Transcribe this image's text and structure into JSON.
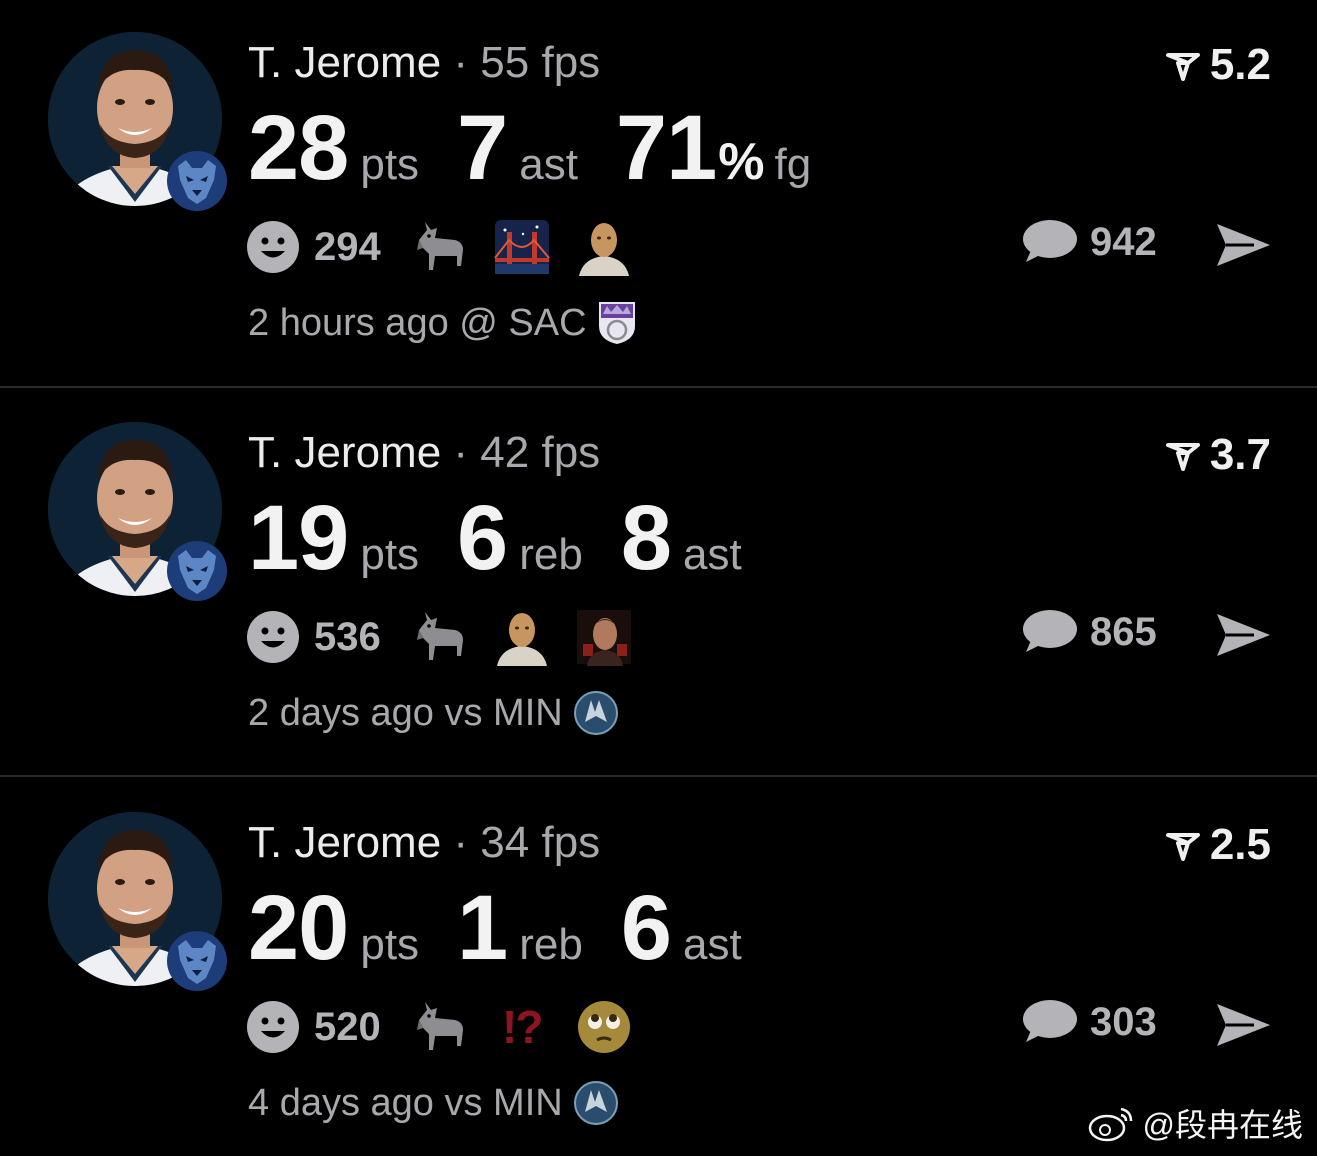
{
  "colors": {
    "background": "#000000",
    "divider": "#2a2a2c",
    "primary_text": "#f2f2f2",
    "secondary_text": "#a9a9ad",
    "icon_gray": "#b4b4b8",
    "interrobang_red": "#8d1520"
  },
  "posts": [
    {
      "player": "T. Jerome",
      "sep": "·",
      "fps": "55 fps",
      "rating": "5.2",
      "stats": [
        {
          "num": "28",
          "pct": "",
          "unit": "pts"
        },
        {
          "num": "7",
          "pct": "",
          "unit": "ast"
        },
        {
          "num": "71",
          "pct": "%",
          "unit": "fg"
        }
      ],
      "reactions_count": "294",
      "reaction_icons": [
        "goat-emoji",
        "bridge-at-night-emoji",
        "masked-person-emoji"
      ],
      "comments_count": "942",
      "time": "2 hours ago",
      "venue": "@ SAC",
      "opponent_logo": "kings-logo-icon"
    },
    {
      "player": "T. Jerome",
      "sep": "·",
      "fps": "42 fps",
      "rating": "3.7",
      "stats": [
        {
          "num": "19",
          "pct": "",
          "unit": "pts"
        },
        {
          "num": "6",
          "pct": "",
          "unit": "reb"
        },
        {
          "num": "8",
          "pct": "",
          "unit": "ast"
        }
      ],
      "reactions_count": "536",
      "reaction_icons": [
        "goat-emoji",
        "masked-person-emoji",
        "person-face-photo-emoji"
      ],
      "comments_count": "865",
      "time": "2 days ago",
      "venue": "vs MIN",
      "opponent_logo": "timberwolves-logo-icon"
    },
    {
      "player": "T. Jerome",
      "sep": "·",
      "fps": "34 fps",
      "rating": "2.5",
      "stats": [
        {
          "num": "20",
          "pct": "",
          "unit": "pts"
        },
        {
          "num": "1",
          "pct": "",
          "unit": "reb"
        },
        {
          "num": "6",
          "pct": "",
          "unit": "ast"
        }
      ],
      "reactions_count": "520",
      "reaction_icons": [
        "goat-emoji",
        "interrobang-emoji",
        "pleading-face-emoji"
      ],
      "interrobang": "!?",
      "comments_count": "303",
      "time": "4 days ago",
      "venue": "vs MIN",
      "opponent_logo": "timberwolves-logo-icon"
    }
  ],
  "watermark": "@段冉在线"
}
